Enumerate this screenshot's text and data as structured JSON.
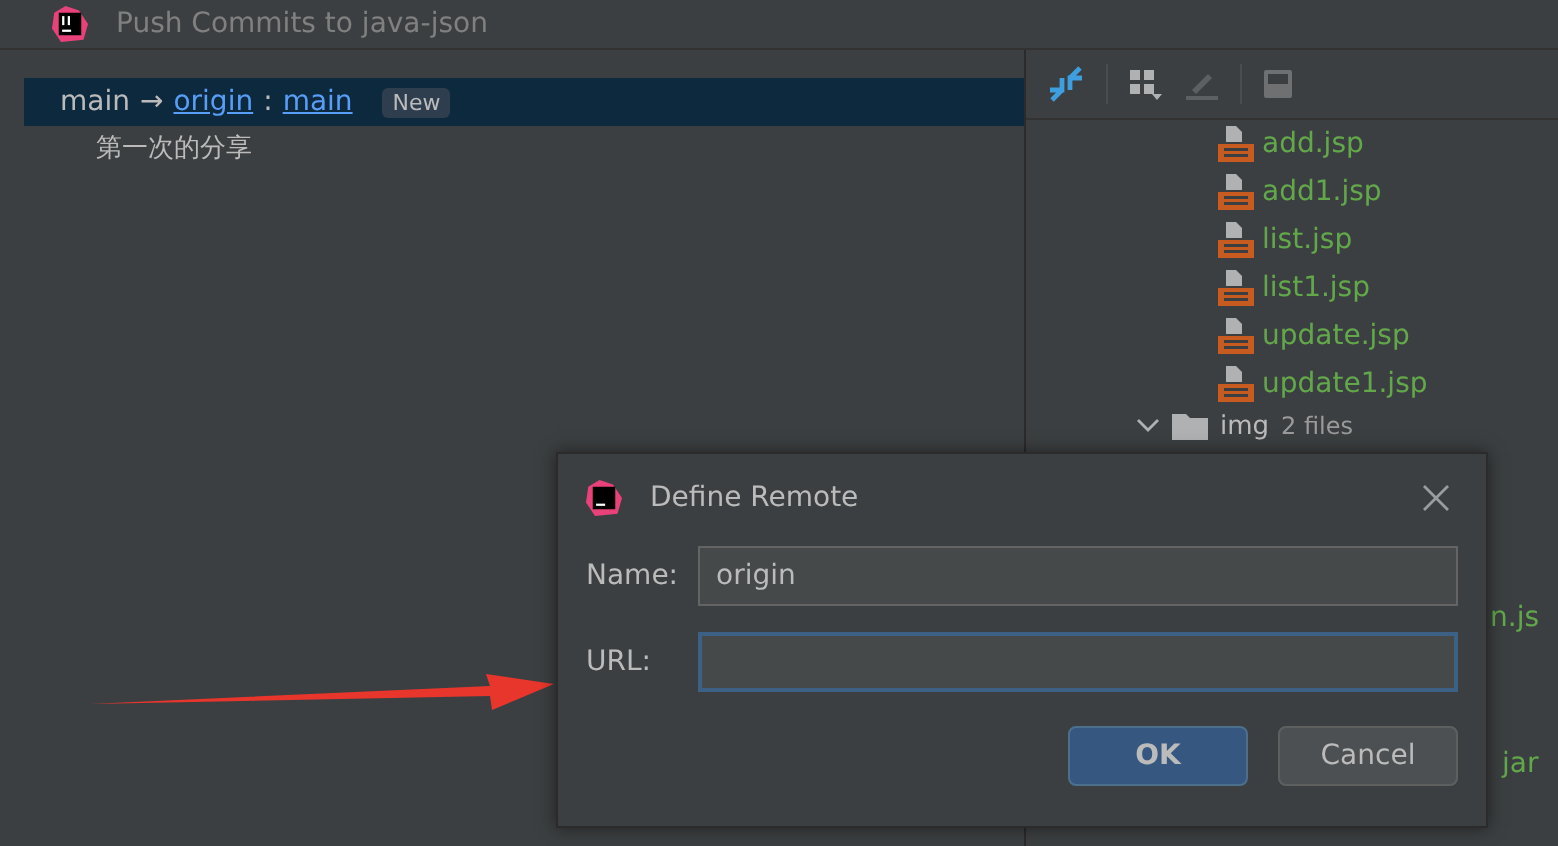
{
  "window": {
    "title": "Push Commits to java-json"
  },
  "commits": {
    "branch": {
      "local": "main",
      "arrow": "→",
      "remote": "origin",
      "separator": ":",
      "remote_branch": "main",
      "badge": "New",
      "selected": true
    },
    "items": [
      {
        "message": "第一次的分享"
      }
    ]
  },
  "files": {
    "items": [
      {
        "kind": "jsp",
        "name": "add.jsp"
      },
      {
        "kind": "jsp",
        "name": "add1.jsp"
      },
      {
        "kind": "jsp",
        "name": "list.jsp"
      },
      {
        "kind": "jsp",
        "name": "list1.jsp"
      },
      {
        "kind": "jsp",
        "name": "update.jsp"
      },
      {
        "kind": "jsp",
        "name": "update1.jsp"
      },
      {
        "kind": "folder",
        "name": "img",
        "count": "2 files",
        "expanded": true
      }
    ],
    "fragments": [
      "n.js",
      "jar"
    ]
  },
  "dialog": {
    "title": "Define Remote",
    "fields": [
      {
        "label": "Name:",
        "value": "origin",
        "focused": false
      },
      {
        "label": "URL:",
        "focused": true
      }
    ],
    "buttons": [
      {
        "label": "OK",
        "default": true
      },
      {
        "label": "Cancel",
        "default": false
      }
    ]
  }
}
